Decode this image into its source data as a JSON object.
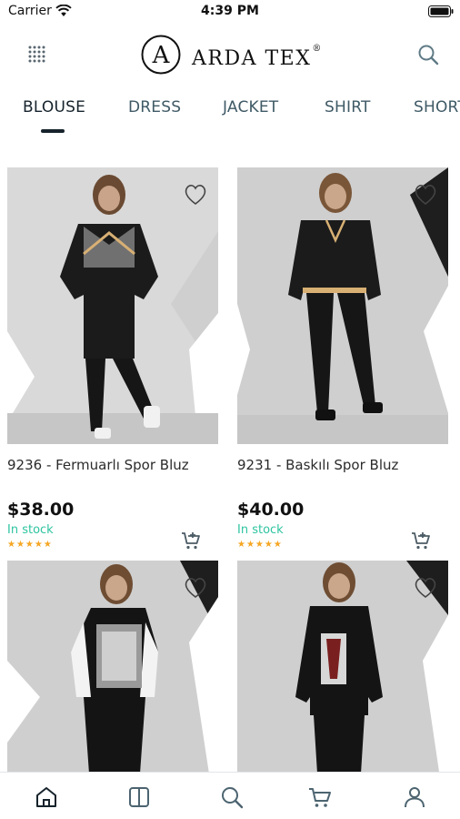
{
  "status_bar": {
    "carrier": "Carrier",
    "time": "4:39 PM"
  },
  "header": {
    "brand_letter": "A",
    "brand_name": "ARDA TEX",
    "brand_mark": "®",
    "menu_icon": "grid-dots-icon",
    "search_icon": "search-icon"
  },
  "tabs": [
    {
      "label": "BLOUSE",
      "active": true
    },
    {
      "label": "DRESS",
      "active": false
    },
    {
      "label": "JACKET",
      "active": false
    },
    {
      "label": "SHIRT",
      "active": false
    },
    {
      "label": "SHORT",
      "active": false
    }
  ],
  "products": [
    {
      "name": "9236 - Fermuarlı Spor Bluz",
      "price": "$38.00",
      "stock": "In stock",
      "rating": "★★★★★"
    },
    {
      "name": "9231 - Baskılı Spor Bluz",
      "price": "$40.00",
      "stock": "In stock",
      "rating": "★★★★★"
    },
    {
      "name": "",
      "price": "",
      "stock": "",
      "rating": ""
    },
    {
      "name": "",
      "price": "",
      "stock": "",
      "rating": ""
    }
  ],
  "bottom_nav": [
    {
      "icon": "home-icon",
      "active": true
    },
    {
      "icon": "catalog-icon",
      "active": false
    },
    {
      "icon": "search-icon",
      "active": false
    },
    {
      "icon": "cart-icon",
      "active": false
    },
    {
      "icon": "profile-icon",
      "active": false
    }
  ],
  "colors": {
    "accent": "#2ec4a0",
    "stars": "#f5a623",
    "text_dark": "#16232c",
    "tab_inactive": "#3f5a66"
  }
}
